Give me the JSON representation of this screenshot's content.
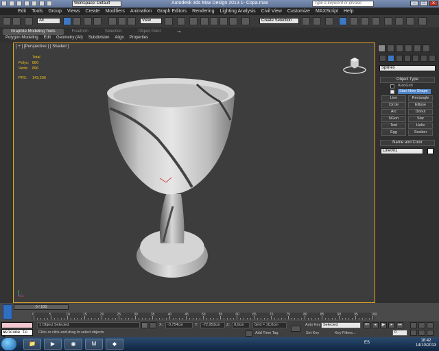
{
  "title_bar": {
    "workspace": "Workspace: Default",
    "app_title": "Autodesk 3ds Max Design 2013    1- Copa.max",
    "search_placeholder": "Type a keyword or phrase"
  },
  "menu": [
    "Edit",
    "Tools",
    "Group",
    "Views",
    "Create",
    "Modifiers",
    "Animation",
    "Graph Editors",
    "Rendering",
    "Lighting Analysis",
    "Civil View",
    "Customize",
    "MAXScript",
    "Help"
  ],
  "toolbar": {
    "filter_value": "All",
    "ref_coord_value": "View",
    "named_selection": "Create Selection"
  },
  "ribbon": {
    "tabs": [
      "Graphite Modeling Tools",
      "Freeform",
      "Selection",
      "Object Paint"
    ],
    "subtabs": [
      "Polygon Modeling",
      "Edit",
      "Geometry (All)",
      "Subdivision",
      "Align",
      "Properties"
    ]
  },
  "viewport": {
    "label": "[ + ] [Perspective ] [ Shaded ]",
    "stats": {
      "header": "Total",
      "polys_label": "Polys:",
      "polys_value": "880",
      "verts_label": "Verts:",
      "verts_value": "896",
      "fps_label": "FPS:",
      "fps_value": "143,206"
    }
  },
  "command_panel": {
    "category": "Splines",
    "object_type_header": "Object Type",
    "autogrid": "AutoGrid",
    "start_new_shape": "Start New Shape",
    "buttons": [
      "Line",
      "Rectangle",
      "Circle",
      "Ellipse",
      "Arc",
      "Donut",
      "NGon",
      "Star",
      "Text",
      "Helix",
      "Egg",
      "Section"
    ],
    "name_color_header": "Name and Color",
    "name_value": "Line001"
  },
  "timeline": {
    "slider_text": "0 / 100",
    "ticks": [
      "0",
      "5",
      "10",
      "15",
      "20",
      "25",
      "30",
      "35",
      "40",
      "45",
      "50",
      "55",
      "60",
      "65",
      "70",
      "75",
      "80",
      "85",
      "90",
      "95",
      "100"
    ]
  },
  "status": {
    "selected": "1 Object Selected",
    "prompt": "Click or click-and-drag to select objects",
    "x_label": "X:",
    "x_value": "-0,754cm",
    "y_label": "Y:",
    "y_value": "-72,953cm",
    "z_label": "Z:",
    "z_value": "0,0cm",
    "grid": "Grid = 10,0cm",
    "add_time_tag": "Add Time Tag",
    "auto_key": "Auto Key",
    "set_key": "Set Key",
    "key_mode": "Selected",
    "key_filters": "Key Filters...",
    "frame": "0",
    "maxscript": "Welcome to M"
  },
  "taskbar": {
    "language": "ES",
    "time": "18:42",
    "date": "14/10/2013"
  }
}
